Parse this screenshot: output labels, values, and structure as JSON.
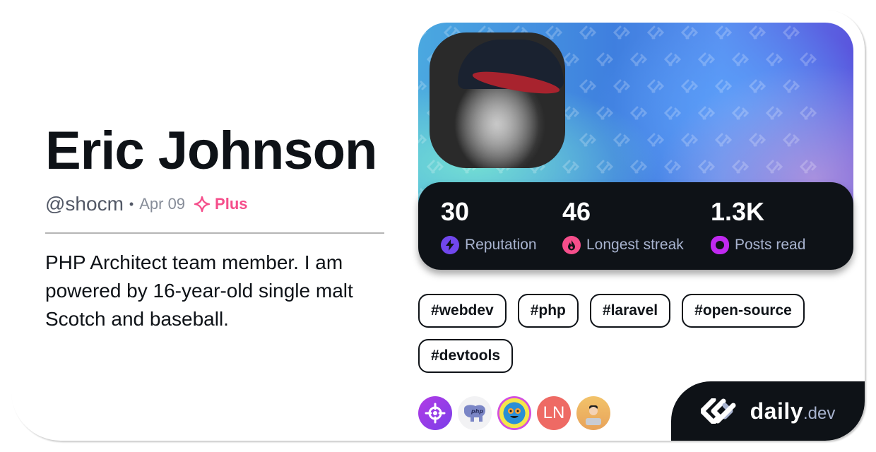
{
  "profile": {
    "name": "Eric Johnson",
    "handle": "@shocm",
    "separator": "•",
    "date": "Apr 09",
    "plus_label": "Plus",
    "bio": "PHP Architect team member. I am powered by 16-year-old single malt Scotch and baseball."
  },
  "stats": [
    {
      "value": "30",
      "label": "Reputation",
      "icon": "lightning-icon",
      "color": "#7147ed"
    },
    {
      "value": "46",
      "label": "Longest streak",
      "icon": "flame-icon",
      "color": "#f54e8b"
    },
    {
      "value": "1.3K",
      "label": "Posts read",
      "icon": "ring-icon",
      "color": "#c029f0"
    }
  ],
  "tags": [
    "#webdev",
    "#php",
    "#laravel",
    "#open-source",
    "#devtools"
  ],
  "sources": [
    {
      "name": "target-source",
      "initials": ""
    },
    {
      "name": "php-elephant-source",
      "initials": ""
    },
    {
      "name": "robot-source",
      "initials": ""
    },
    {
      "name": "ln-source",
      "initials": "LN"
    },
    {
      "name": "devsquad-source",
      "initials": ""
    }
  ],
  "brand": {
    "word": "daily",
    "tld": ".dev"
  },
  "colors": {
    "plus": "#f54e8b",
    "dark": "#0e1217",
    "muted": "#a8b3cf"
  }
}
